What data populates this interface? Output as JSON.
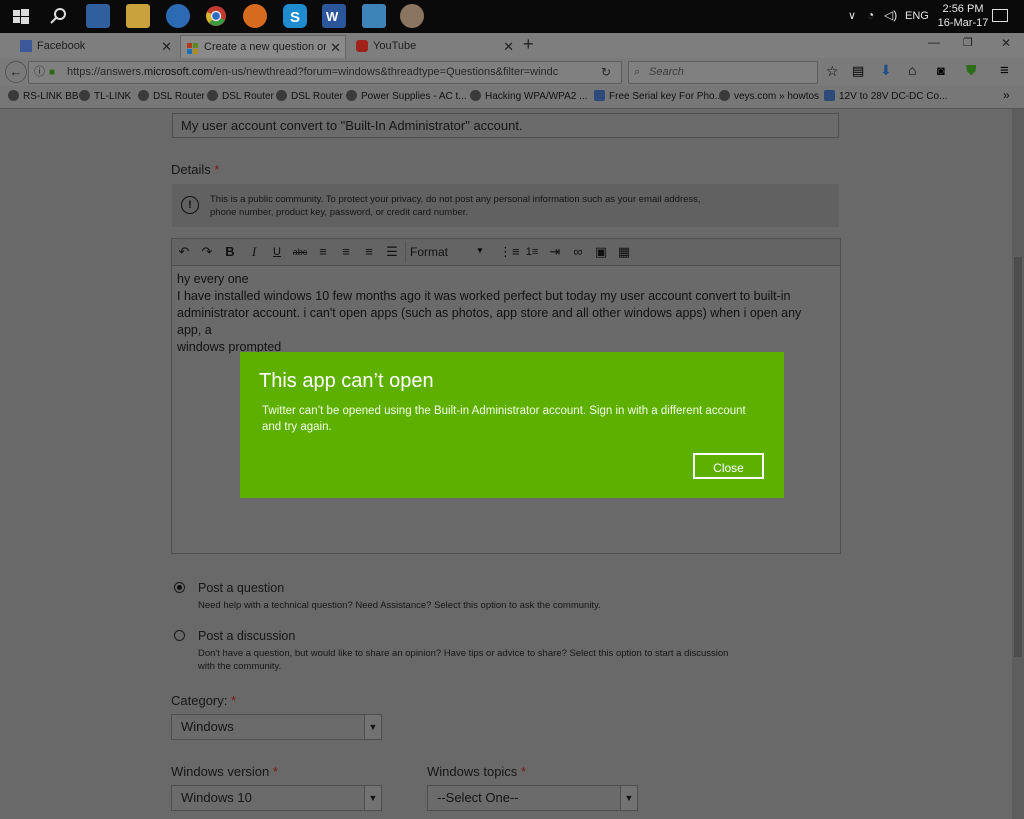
{
  "taskbar": {
    "icons": [
      "windows-start-icon",
      "search-icon",
      "photos-app-icon",
      "file-explorer-icon",
      "skype-for-business-icon",
      "chrome-icon",
      "firefox-icon",
      "skype-icon",
      "word-icon",
      "app-icon",
      "paint-icon"
    ],
    "lang": "ENG",
    "time": "2:56 PM",
    "date": "16-Mar-17"
  },
  "tabs": [
    {
      "label": "Facebook"
    },
    {
      "label": "Create a new question or s..."
    },
    {
      "label": "YouTube"
    }
  ],
  "nav": {
    "url_prefix": "https://answers.",
    "url_domain": "microsoft.com",
    "url_rest": "/en-us/newthread?forum=windows&threadtype=Questions&filter=windc",
    "search_placeholder": "Search"
  },
  "bookmarks": [
    "RS-LINK BB",
    "TL-LINK",
    "DSL Router",
    "DSL Router",
    "DSL Router",
    "Power Supplies - AC t...",
    "Hacking WPA/WPA2 ...",
    "Free Serial key For Pho...",
    "veys.com » howtos",
    "12V to 28V DC-DC Co..."
  ],
  "form": {
    "subject_value": "My user account convert to \"Built-In Administrator\" account.",
    "details_label": "Details",
    "required_mark": "*",
    "notice_line1": "This is a public community. To protect your privacy, do not post any personal information such as your email address,",
    "notice_line2": "phone number, product key, password, or credit card number.",
    "format_label": "Format",
    "editor_lines": [
      "hy every one",
      "I have installed windows 10 few months ago it was worked perfect but today my user account convert to built-in",
      "administrator account. i can't open apps (such as photos, app store and all other windows apps) when i open any app, a",
      "windows prompted"
    ],
    "post_question_label": "Post a question",
    "post_question_desc": "Need help with a technical question? Need Assistance? Select this option to ask the community.",
    "post_discussion_label": "Post a discussion",
    "post_discussion_desc1": "Don't have a question, but would like to share an opinion? Have tips or advice to share? Select this option to start a discussion",
    "post_discussion_desc2": "with the community.",
    "category_label": "Category:",
    "category_value": "Windows",
    "version_label": "Windows version",
    "version_value": "Windows 10",
    "topics_label": "Windows topics",
    "topics_value": "--Select One--"
  },
  "dialog": {
    "title": "This app can’t open",
    "message_line1": "Twitter can’t be opened using the Built-in Administrator account. Sign in with a different account",
    "message_line2": "and try again.",
    "close_label": "Close"
  },
  "colors": {
    "dialog_bg": "#5eb000",
    "overlay": "#696969"
  }
}
